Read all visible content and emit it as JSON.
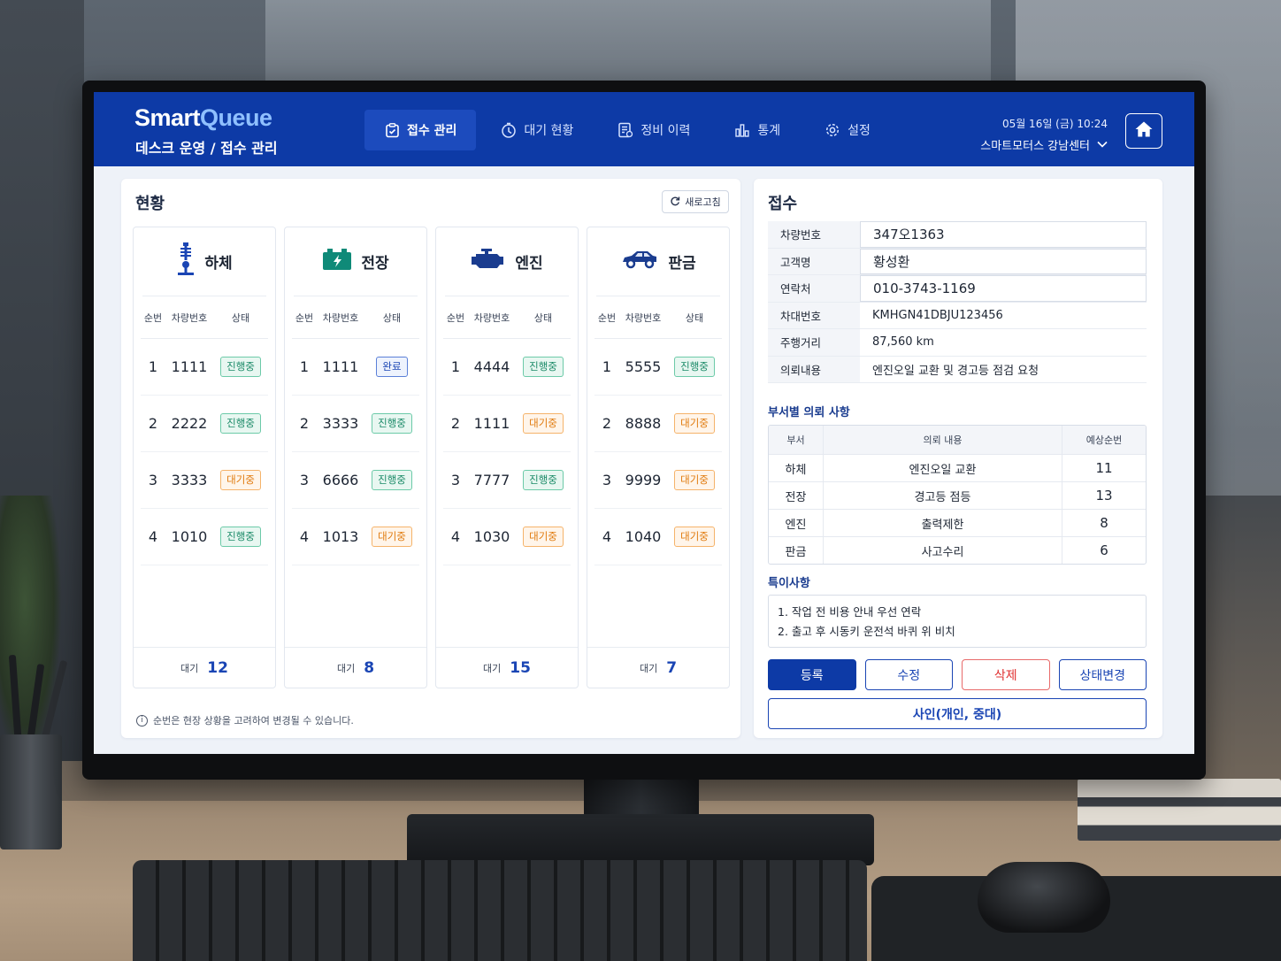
{
  "app": {
    "logo_part1": "Smart",
    "logo_part2": "Queue",
    "breadcrumb": "데스크 운영 / 접수 관리",
    "datetime": "05월 16일 (금) 10:24",
    "center_name": "스마트모터스 강남센터"
  },
  "nav": [
    {
      "label": "접수 관리",
      "icon": "clipboard-icon",
      "active": true
    },
    {
      "label": "대기 현황",
      "icon": "stopwatch-icon",
      "active": false
    },
    {
      "label": "정비 이력",
      "icon": "history-icon",
      "active": false
    },
    {
      "label": "통계",
      "icon": "bar-chart-icon",
      "active": false
    },
    {
      "label": "설정",
      "icon": "gear-icon",
      "active": false
    }
  ],
  "status_panel": {
    "title": "현황",
    "refresh_label": "새로고침",
    "columns": {
      "no": "순번",
      "plate": "차량번호",
      "status": "상태"
    },
    "footer_label": "대기",
    "note": "순번은 현장 상황을 고려하여 변경될 수 있습니다.",
    "departments": [
      {
        "name": "하체",
        "icon": "lift-icon",
        "waiting": "12",
        "rows": [
          {
            "no": "1",
            "plate": "1111",
            "status": "진행중"
          },
          {
            "no": "2",
            "plate": "2222",
            "status": "진행중"
          },
          {
            "no": "3",
            "plate": "3333",
            "status": "대기중"
          },
          {
            "no": "4",
            "plate": "1010",
            "status": "진행중"
          }
        ]
      },
      {
        "name": "전장",
        "icon": "battery-icon",
        "waiting": "8",
        "rows": [
          {
            "no": "1",
            "plate": "1111",
            "status": "완료"
          },
          {
            "no": "2",
            "plate": "3333",
            "status": "진행중"
          },
          {
            "no": "3",
            "plate": "6666",
            "status": "진행중"
          },
          {
            "no": "4",
            "plate": "1013",
            "status": "대기중"
          }
        ]
      },
      {
        "name": "엔진",
        "icon": "engine-icon",
        "waiting": "15",
        "rows": [
          {
            "no": "1",
            "plate": "4444",
            "status": "진행중"
          },
          {
            "no": "2",
            "plate": "1111",
            "status": "대기중"
          },
          {
            "no": "3",
            "plate": "7777",
            "status": "진행중"
          },
          {
            "no": "4",
            "plate": "1030",
            "status": "대기중"
          }
        ]
      },
      {
        "name": "판금",
        "icon": "car-icon",
        "waiting": "7",
        "rows": [
          {
            "no": "1",
            "plate": "5555",
            "status": "진행중"
          },
          {
            "no": "2",
            "plate": "8888",
            "status": "대기중"
          },
          {
            "no": "3",
            "plate": "9999",
            "status": "대기중"
          },
          {
            "no": "4",
            "plate": "1040",
            "status": "대기중"
          }
        ]
      }
    ]
  },
  "reception": {
    "title": "접수",
    "fields": [
      {
        "label": "차량번호",
        "value": "347오1363",
        "editable": true
      },
      {
        "label": "고객명",
        "value": "황성환",
        "editable": true
      },
      {
        "label": "연락처",
        "value": "010-3743-1169",
        "editable": true
      },
      {
        "label": "차대번호",
        "value": "KMHGN41DBJU123456",
        "editable": false
      },
      {
        "label": "주행거리",
        "value": "87,560 km",
        "editable": false
      },
      {
        "label": "의뢰내용",
        "value": "엔진오일 교환 및 경고등 점검 요청",
        "editable": false
      }
    ],
    "dept_requests_title": "부서별 의뢰 사항",
    "dept_requests_headers": [
      "부서",
      "의뢰 내용",
      "예상순번"
    ],
    "dept_requests": [
      {
        "dept": "하체",
        "content": "엔진오일 교환",
        "order": "11"
      },
      {
        "dept": "전장",
        "content": "경고등 점등",
        "order": "13"
      },
      {
        "dept": "엔진",
        "content": "출력제한",
        "order": "8"
      },
      {
        "dept": "판금",
        "content": "사고수리",
        "order": "6"
      }
    ],
    "memo_title": "특이사항",
    "memo_lines": [
      "1. 작업 전 비용 안내 우선 연락",
      "2. 출고 후 시동키 운전석 바퀴 위 비치"
    ],
    "buttons": {
      "register": "등록",
      "edit": "수정",
      "delete": "삭제",
      "status_change": "상태변경"
    },
    "sign_button": "사인(개인, 중대)"
  },
  "colors": {
    "primary": "#0d3aa6",
    "in_progress": "#1a8a67",
    "waiting": "#e07a0d",
    "done": "#1a45b4",
    "danger": "#e03030"
  }
}
